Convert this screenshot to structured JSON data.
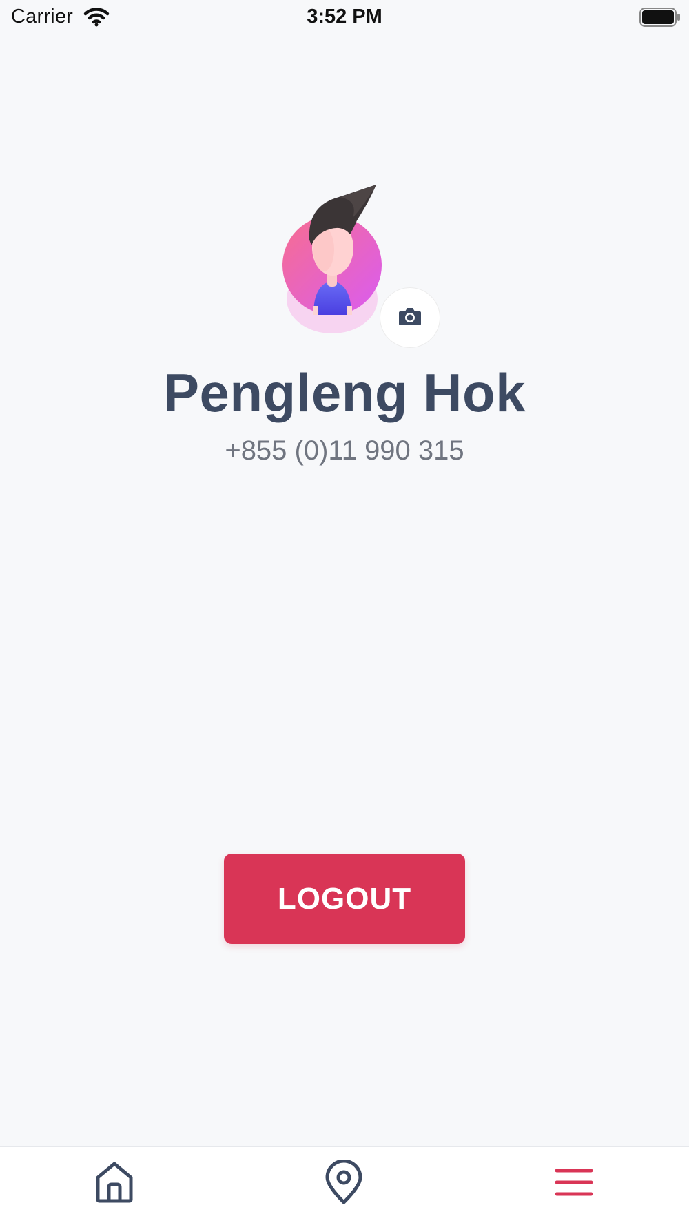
{
  "status_bar": {
    "carrier": "Carrier",
    "time": "3:52 PM",
    "wifi_icon": "wifi-icon",
    "battery_icon": "battery-full-icon"
  },
  "profile": {
    "avatar_icon": "user-avatar-illustration",
    "camera_icon": "camera-icon",
    "name": "Pengleng Hok",
    "phone": "+855 (0)11 990 315"
  },
  "actions": {
    "logout_label": "LOGOUT"
  },
  "tab_bar": {
    "items": [
      {
        "icon": "home-icon",
        "active": false
      },
      {
        "icon": "location-pin-icon",
        "active": false
      },
      {
        "icon": "menu-icon",
        "active": true
      }
    ]
  },
  "colors": {
    "background": "#f7f8fa",
    "primary_text": "#3d4a62",
    "secondary_text": "#707580",
    "accent": "#d93556",
    "tab_inactive": "#3d4a62",
    "avatar_gradient_start": "#f76d8f",
    "avatar_gradient_end": "#d95cf2"
  }
}
